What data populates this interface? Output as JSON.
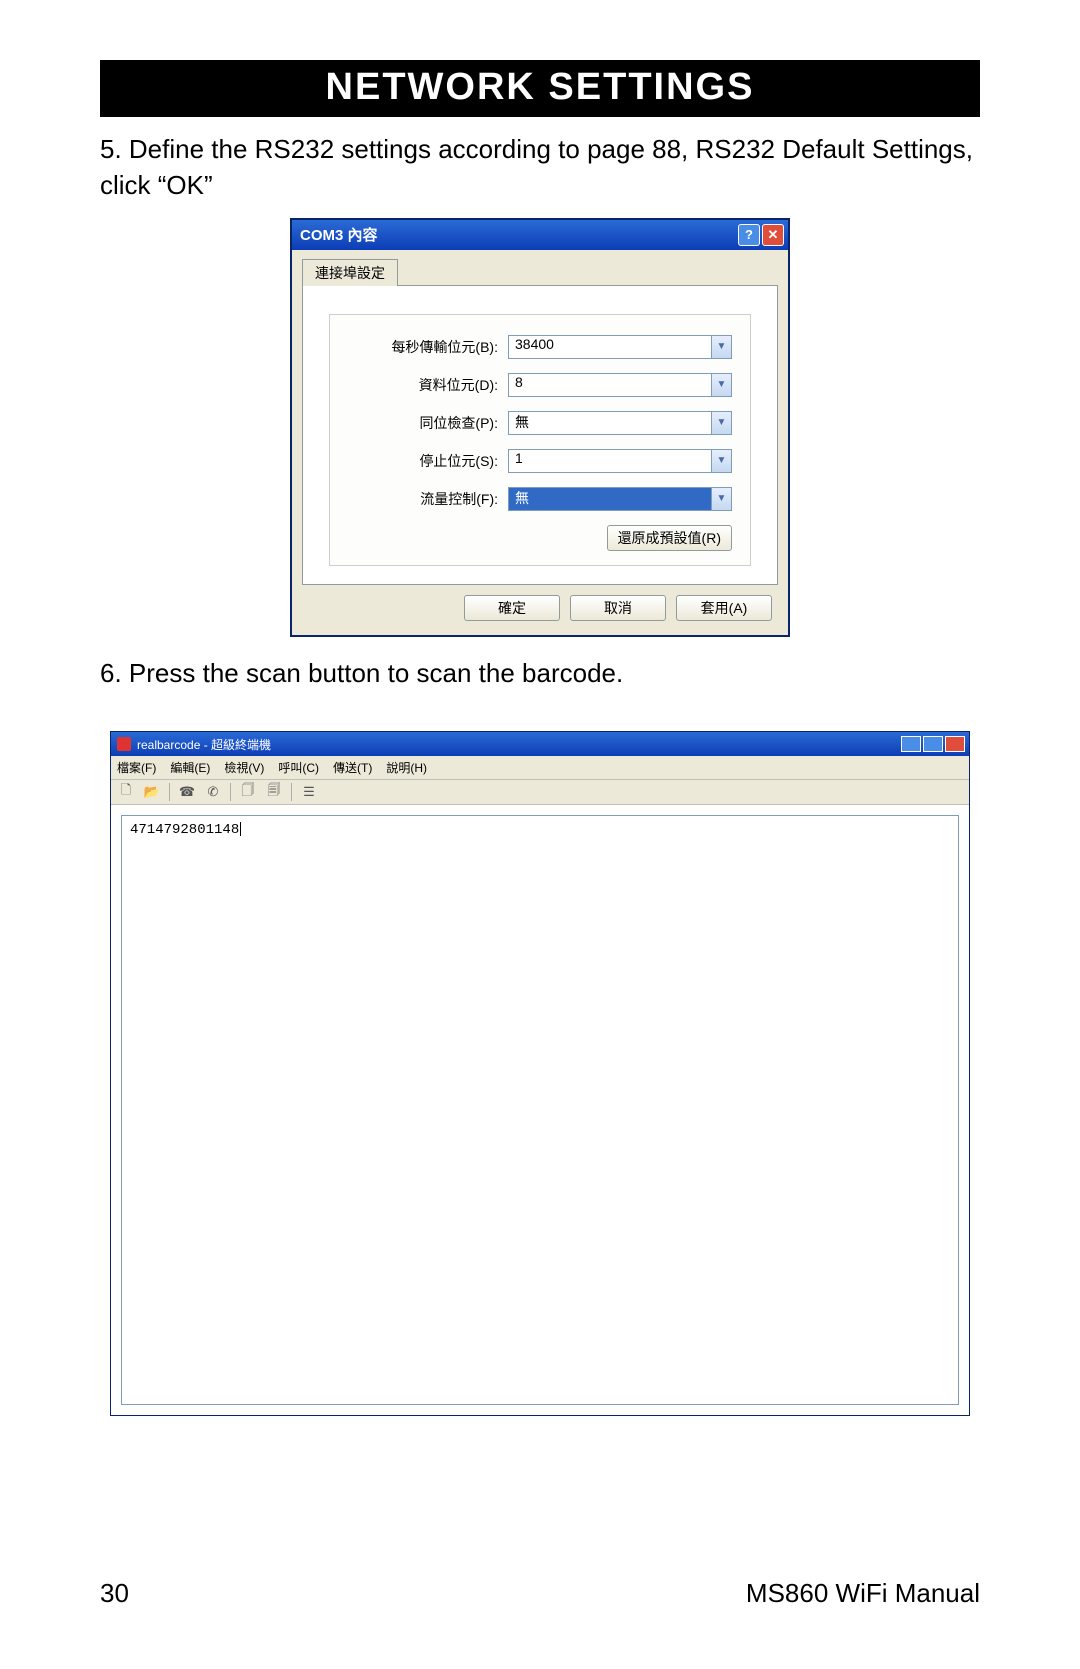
{
  "header": {
    "title": "NETWORK SETTINGS"
  },
  "steps": {
    "s5": "5. Define the RS232 settings according to page 88,  RS232 Default Settings, click “OK”",
    "s6": "6. Press the scan button to scan the barcode."
  },
  "dialog": {
    "title": "COM3 內容",
    "help_glyph": "?",
    "close_glyph": "✕",
    "tab_label": "連接埠設定",
    "rows": {
      "baud": {
        "label": "每秒傳輸位元(B):",
        "value": "38400"
      },
      "data": {
        "label": "資料位元(D):",
        "value": "8"
      },
      "parity": {
        "label": "同位檢查(P):",
        "value": "無"
      },
      "stop": {
        "label": "停止位元(S):",
        "value": "1"
      },
      "flow": {
        "label": "流量控制(F):",
        "value": "無"
      }
    },
    "restore_label": "還原成預設值(R)",
    "ok_label": "確定",
    "cancel_label": "取消",
    "apply_label": "套用(A)"
  },
  "editor": {
    "title": "realbarcode - 超級終端機",
    "menus": [
      "檔案(F)",
      "編輯(E)",
      "檢視(V)",
      "呼叫(C)",
      "傳送(T)",
      "說明(H)"
    ],
    "content": "4714792801148"
  },
  "footer": {
    "page": "30",
    "doc": "MS860 WiFi Manual"
  },
  "glyphs": {
    "chevron_down": "▼"
  }
}
